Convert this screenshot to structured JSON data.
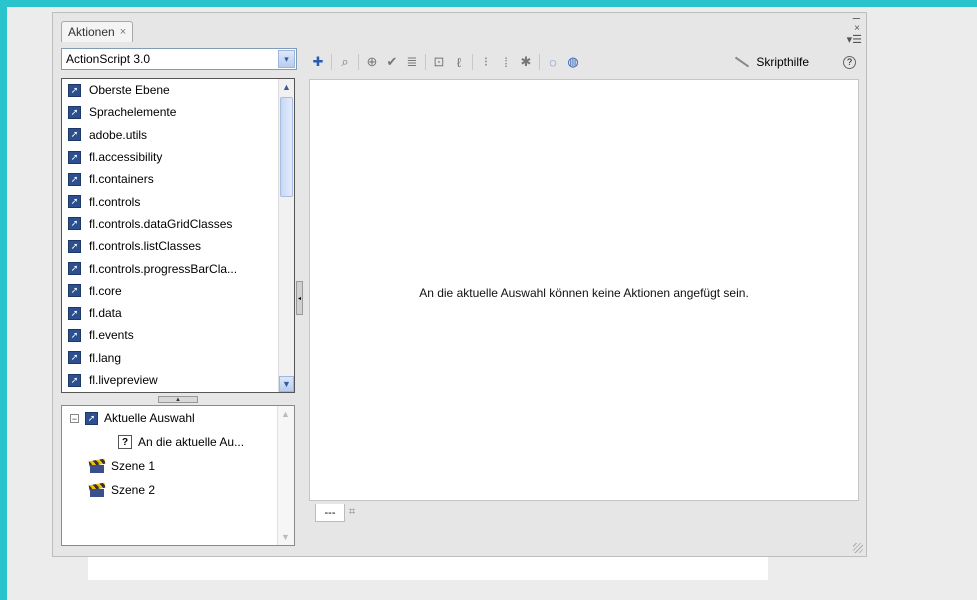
{
  "panel": {
    "tab_label": "Aktionen",
    "tab_close": "×",
    "minimize_symbol": "–",
    "close_symbol": "×",
    "menu_symbol": "▾☰"
  },
  "language_select": {
    "value": "ActionScript 3.0",
    "arrow": "▾"
  },
  "toolbox": {
    "items": [
      {
        "label": "Oberste Ebene",
        "icon": "package-icon"
      },
      {
        "label": "Sprachelemente",
        "icon": "package-icon"
      },
      {
        "label": "adobe.utils",
        "icon": "package-icon"
      },
      {
        "label": "fl.accessibility",
        "icon": "package-icon"
      },
      {
        "label": "fl.containers",
        "icon": "package-icon"
      },
      {
        "label": "fl.controls",
        "icon": "package-icon"
      },
      {
        "label": "fl.controls.dataGridClasses",
        "icon": "package-icon"
      },
      {
        "label": "fl.controls.listClasses",
        "icon": "package-icon"
      },
      {
        "label": "fl.controls.progressBarCla...",
        "icon": "package-icon"
      },
      {
        "label": "fl.core",
        "icon": "package-icon"
      },
      {
        "label": "fl.data",
        "icon": "package-icon"
      },
      {
        "label": "fl.events",
        "icon": "package-icon"
      },
      {
        "label": "fl.lang",
        "icon": "package-icon"
      },
      {
        "label": "fl.livepreview",
        "icon": "package-icon"
      }
    ]
  },
  "script_navigator": {
    "items": [
      {
        "label": "Aktuelle Auswahl",
        "expander": "⊟"
      },
      {
        "label": "An die aktuelle Au..."
      },
      {
        "label": "Szene 1"
      },
      {
        "label": "Szene 2"
      }
    ]
  },
  "toolbar": {
    "buttons": [
      {
        "name": "add-statement-icon",
        "glyph": "✚"
      },
      {
        "name": "find-icon",
        "glyph": "⌕"
      },
      {
        "name": "target-path-icon",
        "glyph": "⊕"
      },
      {
        "name": "check-syntax-icon",
        "glyph": "✔"
      },
      {
        "name": "auto-format-icon",
        "glyph": "≣"
      },
      {
        "name": "code-hint-icon",
        "glyph": "⊡"
      },
      {
        "name": "debug-options-icon",
        "glyph": "ℓ"
      },
      {
        "name": "collapse-between-braces-icon",
        "glyph": "⁝"
      },
      {
        "name": "collapse-selection-icon",
        "glyph": "⁞"
      },
      {
        "name": "expand-all-icon",
        "glyph": "✱"
      },
      {
        "name": "apply-block-comment-icon",
        "glyph": "◌"
      },
      {
        "name": "apply-line-comment-icon",
        "glyph": "◍"
      }
    ],
    "script_help_label": "Skripthilfe",
    "help_symbol": "?"
  },
  "editor": {
    "message": "An die aktuelle Auswahl können keine Aktionen angefügt sein."
  },
  "bottom_tabs": {
    "tab_label": "---",
    "pin_symbol": "⌗"
  },
  "colors": {
    "frame": "#29c4cc",
    "panel_bg": "#e6e6e6",
    "package_icon": "#2c4f8f"
  }
}
